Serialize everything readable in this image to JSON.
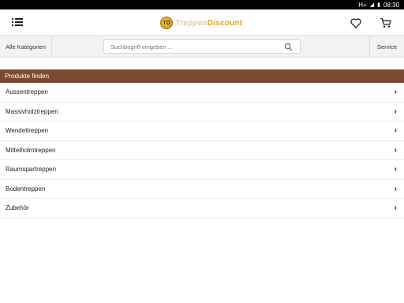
{
  "statusbar": {
    "network": "H+",
    "time": "08:30"
  },
  "header": {
    "logo_text_a": "Treppen",
    "logo_text_b": "Discount",
    "logo_badge": "TD"
  },
  "subbar": {
    "categories_label": "Alle Kategorien",
    "search_placeholder": "Suchbegriff eingeben ...",
    "service_label": "Service"
  },
  "section": {
    "title": "Produkte finden"
  },
  "categories": [
    {
      "label": "Aussentreppen"
    },
    {
      "label": "Massivholztreppen"
    },
    {
      "label": "Wendeltreppen"
    },
    {
      "label": "Mittelholmtreppen"
    },
    {
      "label": "Raumspartreppen"
    },
    {
      "label": "Bodentreppen"
    },
    {
      "label": "Zubehör"
    }
  ],
  "colors": {
    "section_bg": "#7b4a2e",
    "logo_gold": "#e3a21a"
  }
}
